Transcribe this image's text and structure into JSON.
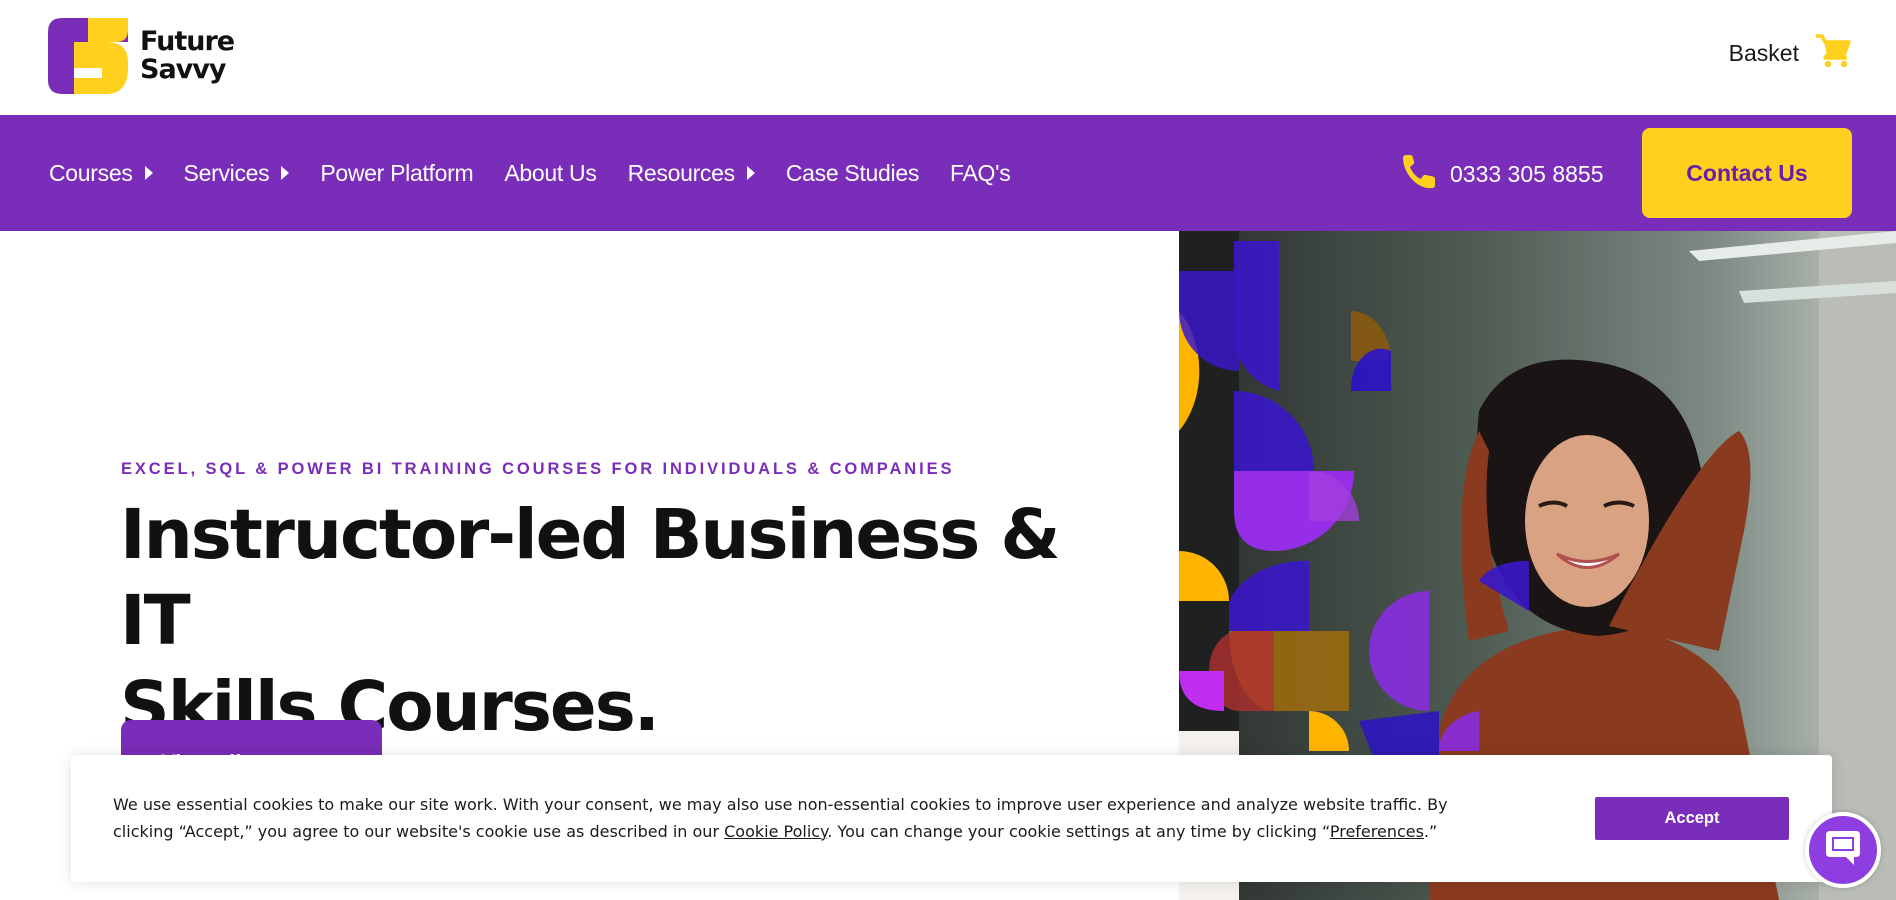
{
  "brand": {
    "name_line1": "Future",
    "name_line2": "Savvy",
    "purple": "#7a2db8",
    "yellow": "#ffd11e",
    "logo_icon": "future-savvy-logo-icon"
  },
  "header": {
    "basket_label": "Basket",
    "basket_icon": "shopping-cart-icon"
  },
  "nav": {
    "items": [
      {
        "label": "Courses",
        "has_submenu": true
      },
      {
        "label": "Services",
        "has_submenu": true
      },
      {
        "label": "Power Platform",
        "has_submenu": false
      },
      {
        "label": "About Us",
        "has_submenu": false
      },
      {
        "label": "Resources",
        "has_submenu": true
      },
      {
        "label": "Case Studies",
        "has_submenu": false
      },
      {
        "label": "FAQ's",
        "has_submenu": false
      }
    ],
    "phone": "0333 305 8855",
    "phone_icon": "phone-icon",
    "contact_label": "Contact Us"
  },
  "hero": {
    "eyebrow": "EXCEL, SQL & POWER BI TRAINING COURSES FOR INDIVIDUALS & COMPANIES",
    "headline_line1": "Instructor-led Business & IT",
    "headline_line2": "Skills Courses.",
    "button_label": "View all courses",
    "image": "smiling-woman-with-geometric-shapes"
  },
  "cookie_banner": {
    "text_part1": "We use essential cookies to make our site work. With your consent, we may also use non-essential cookies to improve user experience and analyze website traffic. By clicking “Accept,” you agree to our website's cookie use as described in our ",
    "cookie_policy_link": "Cookie Policy",
    "text_part2": ". You can change your cookie settings at any time by clicking “",
    "preferences_link": "Preferences",
    "text_part3": ".”",
    "accept_label": "Accept"
  },
  "chat": {
    "icon": "chat-bubble-icon"
  }
}
